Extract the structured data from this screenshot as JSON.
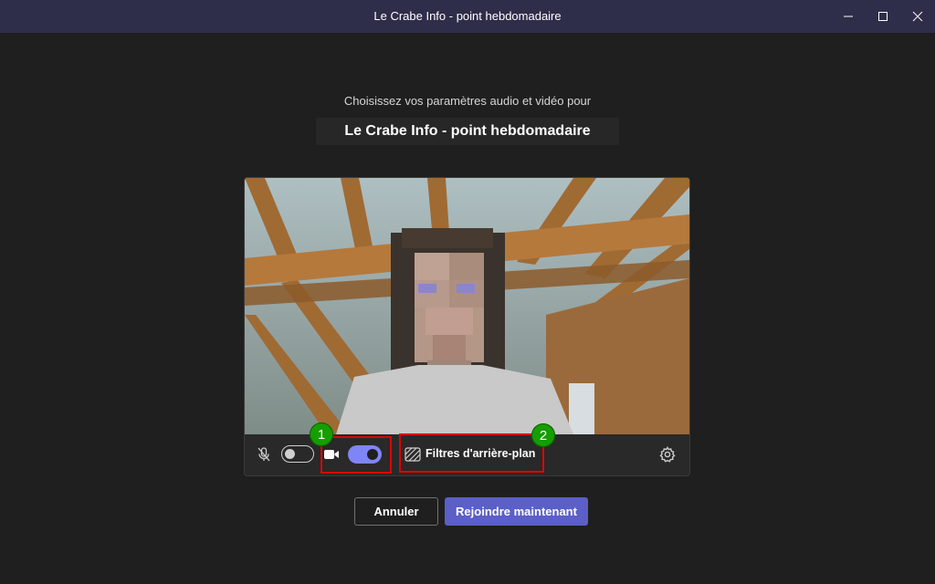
{
  "window": {
    "title": "Le Crabe Info - point hebdomadaire",
    "controls": [
      "minimize-icon",
      "maximize-icon",
      "close-icon"
    ]
  },
  "prejoin": {
    "subtitle": "Choisissez vos paramètres audio et vidéo pour",
    "meeting_title": "Le Crabe Info - point hebdomadaire"
  },
  "video_controls": {
    "microphone": {
      "icon": "mic-off-icon",
      "enabled": false
    },
    "camera": {
      "icon": "camera-icon",
      "enabled": true
    },
    "background_filters": {
      "icon": "background-filter-icon",
      "label": "Filtres d'arrière-plan"
    },
    "settings": {
      "icon": "gear-icon"
    }
  },
  "annotations": {
    "badge_1": "1",
    "badge_2": "2",
    "color_highlight": "#e00000",
    "color_badge": "#169d00"
  },
  "buttons": {
    "cancel": "Annuler",
    "join": "Rejoindre maintenant"
  },
  "colors": {
    "accent": "#5b5fc7",
    "toggle_on": "#7f85f5",
    "titlebar": "#2e2e4a",
    "background": "#1f1f1f"
  }
}
